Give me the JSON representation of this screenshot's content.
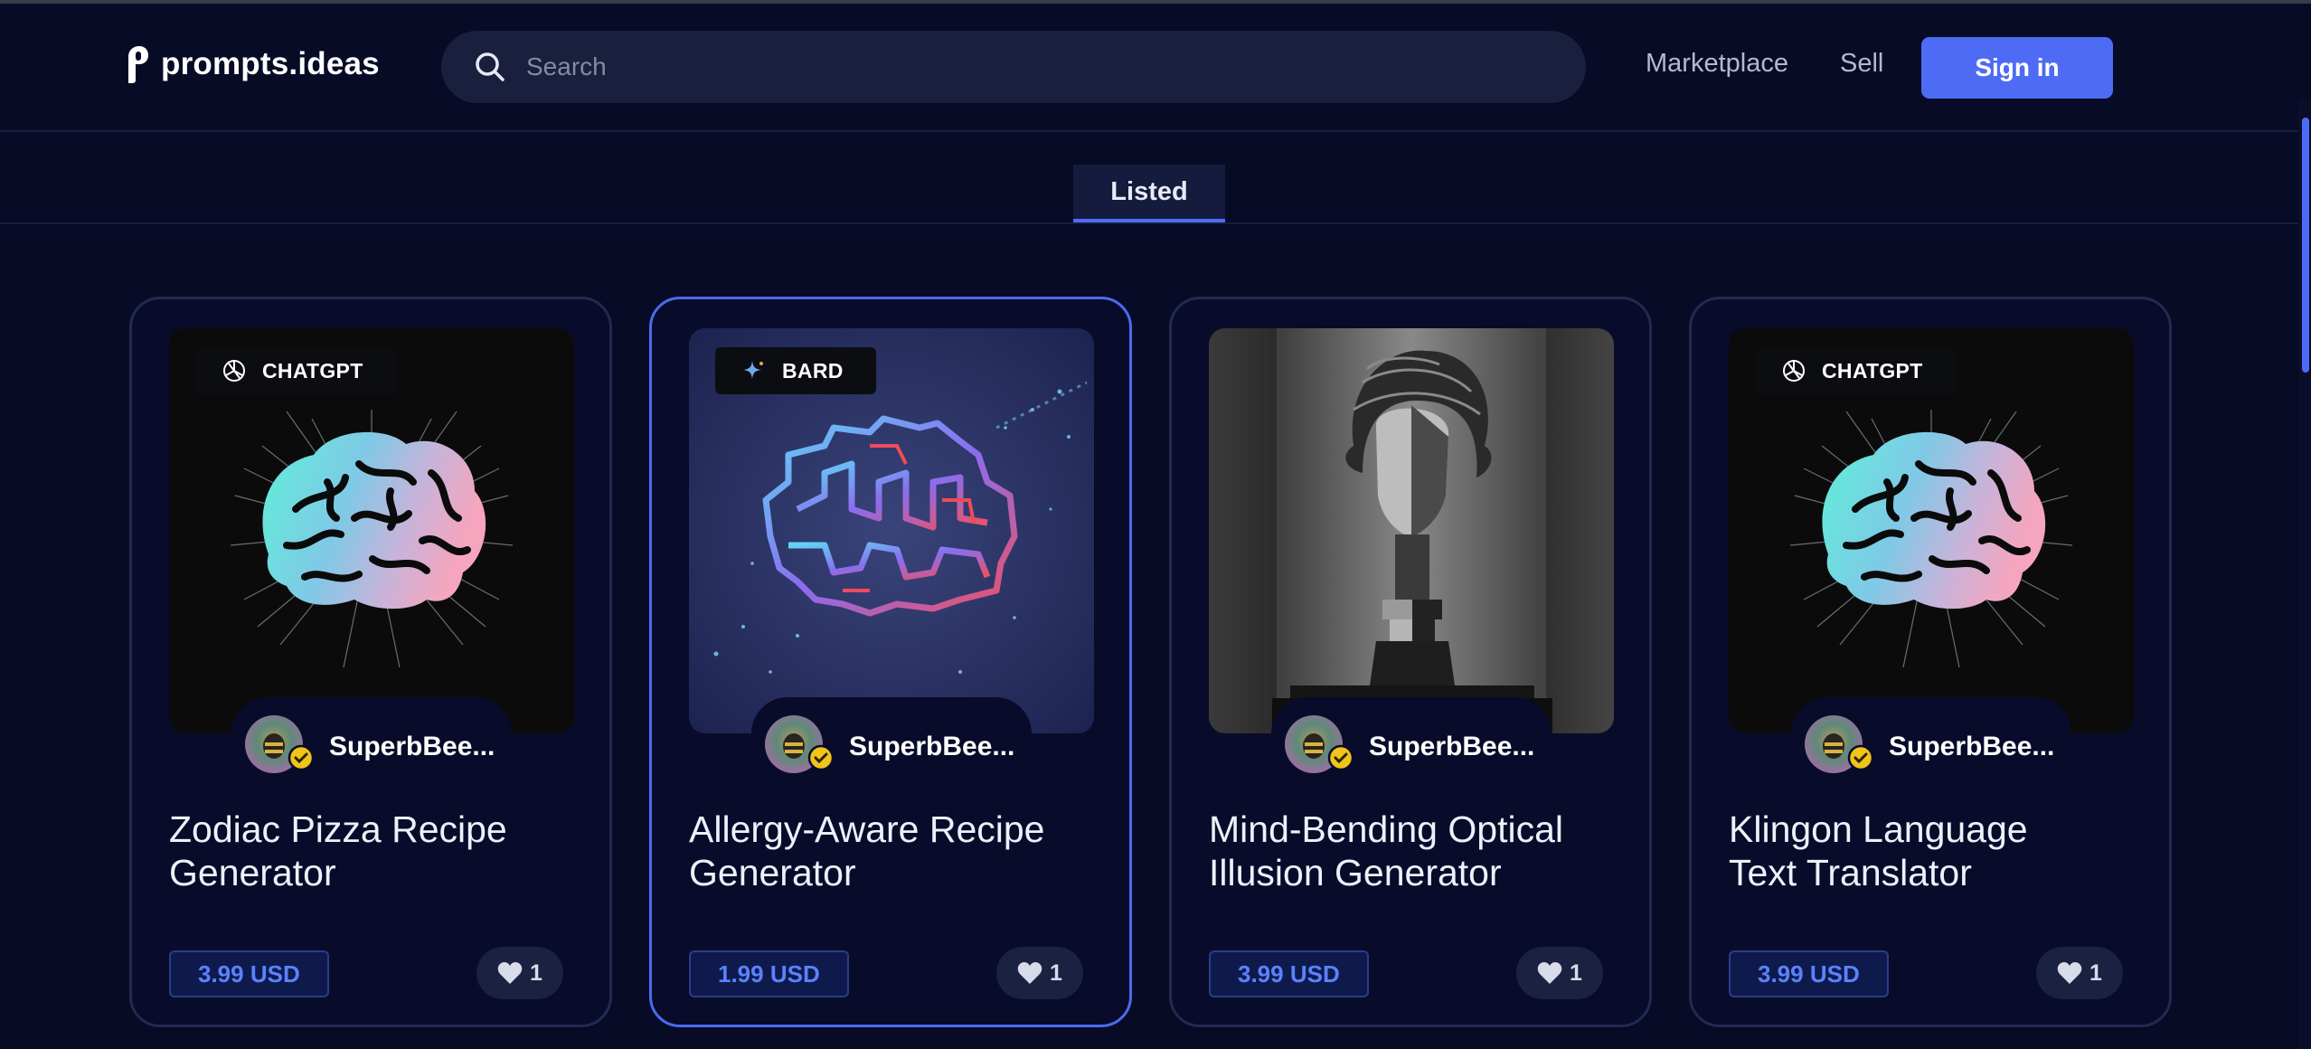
{
  "header": {
    "logo_text": "prompts.ideas",
    "search_placeholder": "Search",
    "nav": [
      "Marketplace",
      "Sell"
    ],
    "signin_label": "Sign in"
  },
  "tabs": [
    {
      "label": "Listed",
      "active": true
    }
  ],
  "colors": {
    "accent": "#4e6bf5",
    "background": "#070b26",
    "card_border": "#222a52",
    "price_text": "#5a82ff"
  },
  "cards": [
    {
      "model": "CHATGPT",
      "model_icon": "openai-icon",
      "image": "gradient-brain",
      "author": "SuperbBee...",
      "title_line1": "Zodiac Pizza Recipe",
      "title_line2": "Generator",
      "price": "3.99 USD",
      "likes": "1",
      "selected": false
    },
    {
      "model": "BARD",
      "model_icon": "bard-sparkle-icon",
      "image": "neon-circuit-brain",
      "author": "SuperbBee...",
      "title_line1": "Allergy-Aware Recipe",
      "title_line2": "Generator",
      "price": "1.99 USD",
      "likes": "1",
      "selected": true
    },
    {
      "model": "",
      "model_icon": "",
      "image": "sculpture-bust",
      "author": "SuperbBee...",
      "title_line1": "Mind-Bending Optical",
      "title_line2": "Illusion Generator",
      "price": "3.99 USD",
      "likes": "1",
      "selected": false
    },
    {
      "model": "CHATGPT",
      "model_icon": "openai-icon",
      "image": "gradient-brain",
      "author": "SuperbBee...",
      "title_line1": "Klingon Language",
      "title_line2": "Text Translator",
      "price": "3.99 USD",
      "likes": "1",
      "selected": false
    }
  ]
}
